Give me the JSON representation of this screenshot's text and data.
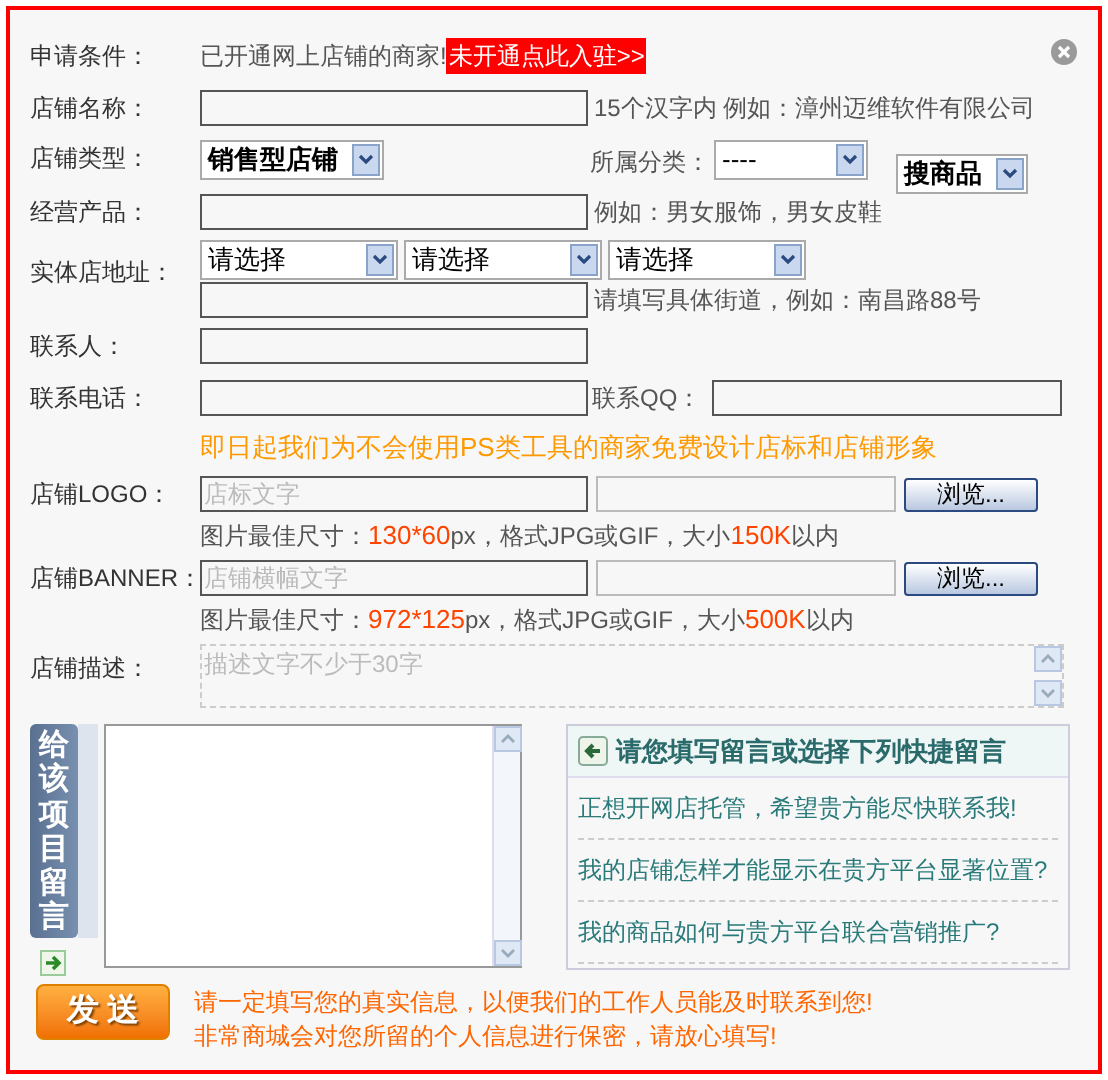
{
  "rows": [
    {
      "kind": "text",
      "label": "申请条件：",
      "text": "已开通网上店铺的商家!",
      "link": "未开通点此入驻>>"
    },
    {
      "kind": "input",
      "label": "店铺名称：",
      "hint": "15个汉字内  例如：漳州迈维软件有限公司"
    },
    {
      "kind": "type",
      "label": "店铺类型：",
      "select": "销售型店铺",
      "category_label": "所属分类：",
      "category": "----",
      "search_select": "搜商品"
    },
    {
      "kind": "input",
      "label": "经营产品：",
      "hint": "例如：男女服饰，男女皮鞋"
    },
    {
      "kind": "address",
      "label": "实体店地址：",
      "selects": [
        "请选择",
        "请选择",
        "请选择"
      ],
      "hint": "请填写具体街道，例如：南昌路88号"
    },
    {
      "kind": "input",
      "label": "联系人："
    },
    {
      "kind": "phone",
      "label": "联系电话：",
      "qq_label": "联系QQ："
    },
    {
      "kind": "notice",
      "text": "即日起我们为不会使用PS类工具的商家免费设计店标和店铺形象"
    },
    {
      "kind": "upload",
      "label": "店铺LOGO：",
      "placeholder": "店标文字",
      "button": "浏览...",
      "hint": "图片最佳尺寸：**130*60**px，格式JPG或GIF，大小**150K**以内"
    },
    {
      "kind": "upload",
      "label": "店铺BANNER：",
      "placeholder": "店铺横幅文字",
      "button": "浏览...",
      "hint": "图片最佳尺寸：**972*125**px，格式JPG或GIF，大小**500K**以内"
    },
    {
      "kind": "textarea",
      "label": "店铺描述：",
      "placeholder": "描述文字不少于30字"
    }
  ],
  "message": {
    "tab_label": "给该项目留言",
    "quick_title": "请您填写留言或选择下列快捷留言",
    "quick_items": [
      "正想开网店托管，希望贵方能尽快联系我!",
      "我的店铺怎样才能显示在贵方平台显著位置?",
      "我的商品如何与贵方平台联合营销推广?"
    ]
  },
  "send": {
    "button": "发 送",
    "notes": [
      "请一定填写您的真实信息，以便我们的工作人员能及时联系到您!",
      "非常商城会对您所留的个人信息进行保密，请放心填写!"
    ]
  }
}
